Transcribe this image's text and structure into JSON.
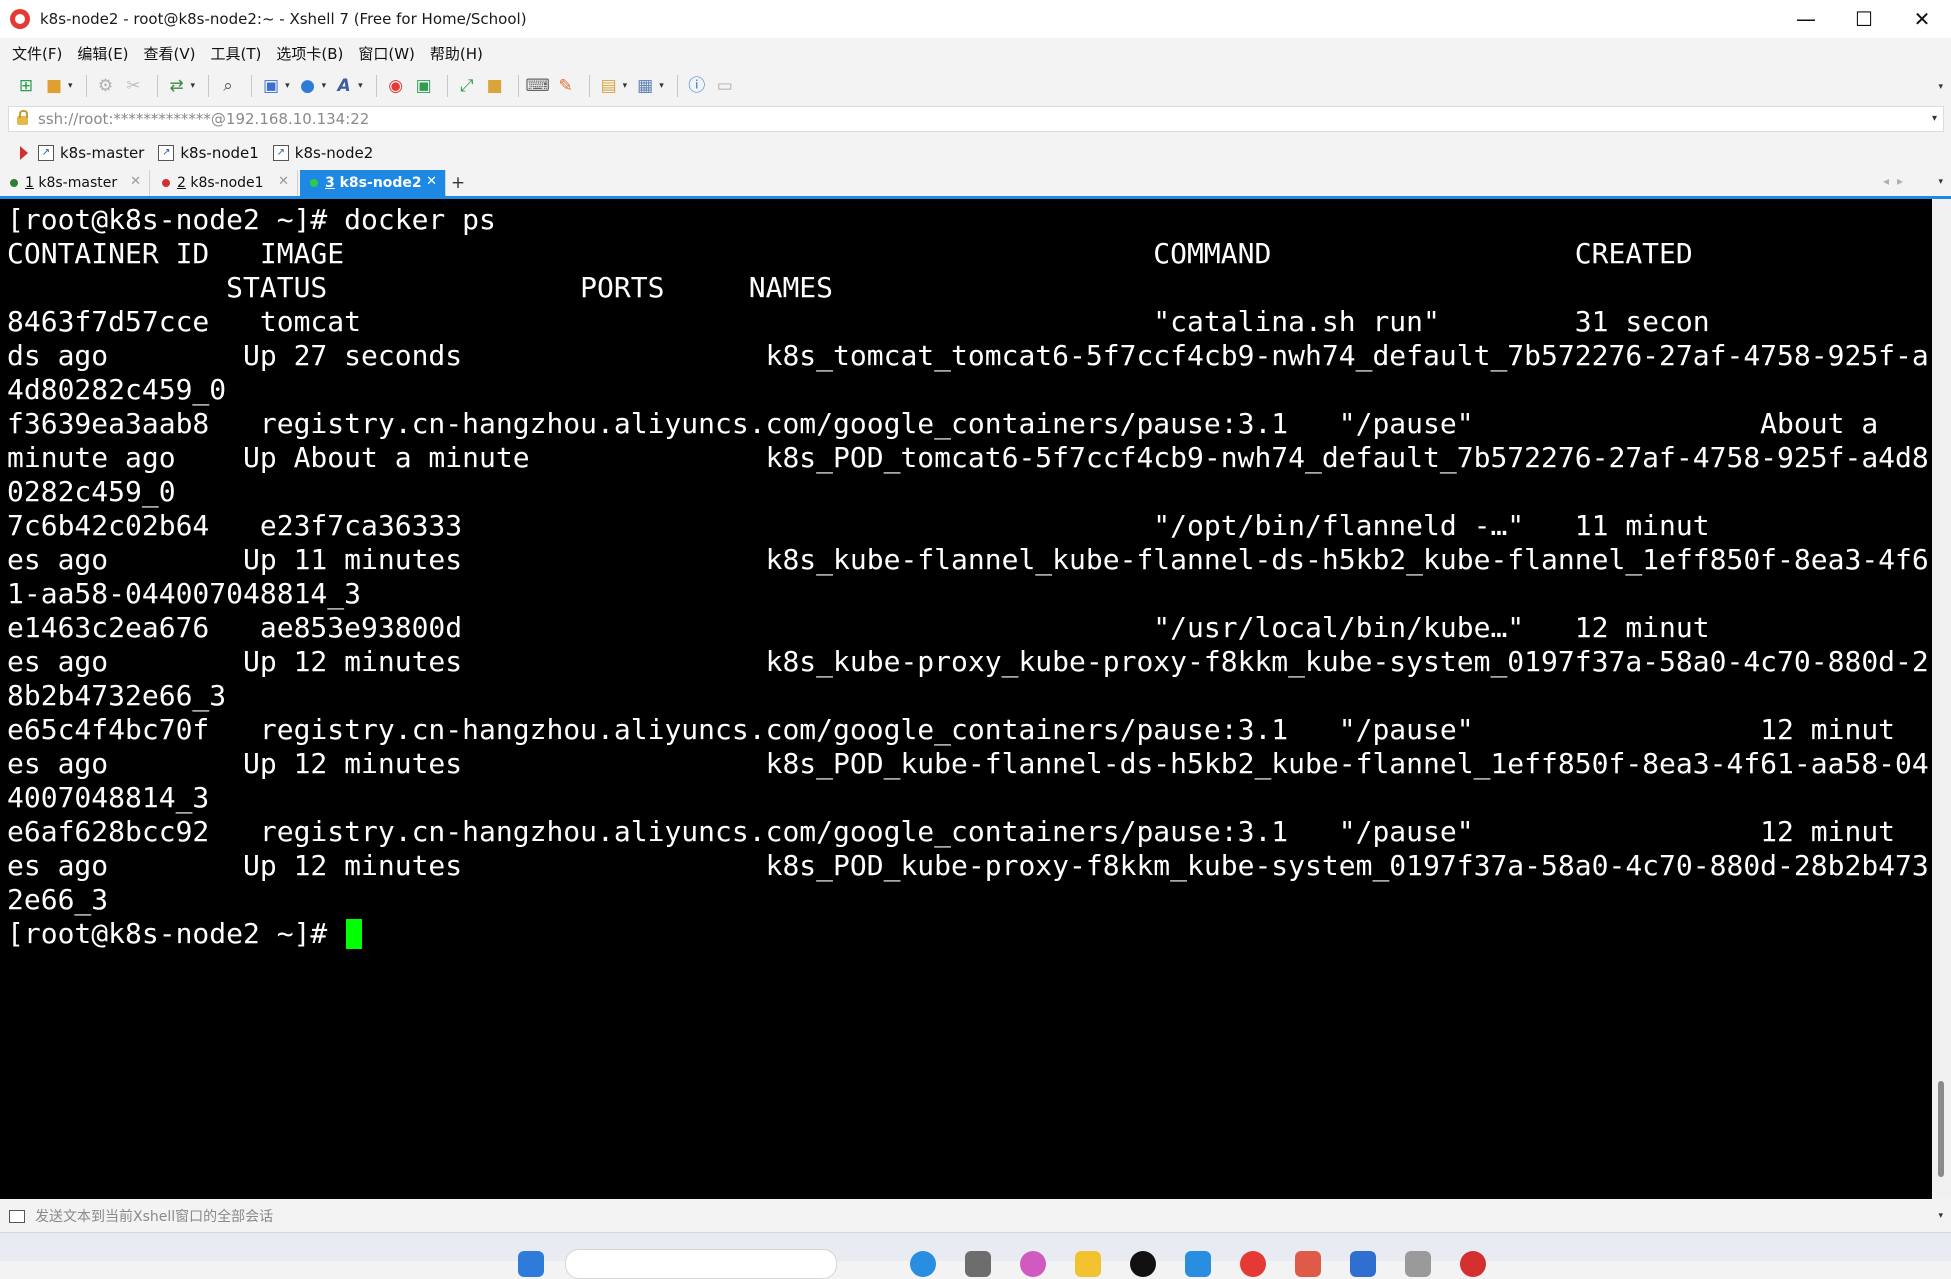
{
  "window": {
    "title": "k8s-node2 - root@k8s-node2:~ - Xshell 7 (Free for Home/School)",
    "minimize": "—",
    "maximize": "☐",
    "close": "✕"
  },
  "menu": [
    "文件(F)",
    "编辑(E)",
    "查看(V)",
    "工具(T)",
    "选项卡(B)",
    "窗口(W)",
    "帮助(H)"
  ],
  "address": {
    "value": "ssh://root:*************@192.168.10.134:22"
  },
  "links": [
    "k8s-master",
    "k8s-node1",
    "k8s-node2"
  ],
  "tabs": [
    {
      "number": "1",
      "label": "k8s-master",
      "dot_color": "#2e7d32"
    },
    {
      "number": "2",
      "label": "k8s-node1",
      "dot_color": "#d32f2f"
    },
    {
      "number": "3",
      "label": "k8s-node2",
      "dot_color": "#2e7d32"
    }
  ],
  "terminal": {
    "lines": [
      "[root@k8s-node2 ~]# docker ps",
      "CONTAINER ID   IMAGE                                                COMMAND                  CREATED",
      "             STATUS               PORTS     NAMES",
      "8463f7d57cce   tomcat                                               \"catalina.sh run\"        31 secon",
      "ds ago        Up 27 seconds                  k8s_tomcat_tomcat6-5f7ccf4cb9-nwh74_default_7b572276-27af-4758-925f-a",
      "4d80282c459_0",
      "f3639ea3aab8   registry.cn-hangzhou.aliyuncs.com/google_containers/pause:3.1   \"/pause\"                 About a",
      "minute ago    Up About a minute              k8s_POD_tomcat6-5f7ccf4cb9-nwh74_default_7b572276-27af-4758-925f-a4d8",
      "0282c459_0",
      "7c6b42c02b64   e23f7ca36333                                         \"/opt/bin/flanneld -…\"   11 minut",
      "es ago        Up 11 minutes                  k8s_kube-flannel_kube-flannel-ds-h5kb2_kube-flannel_1eff850f-8ea3-4f6",
      "1-aa58-044007048814_3",
      "e1463c2ea676   ae853e93800d                                         \"/usr/local/bin/kube…\"   12 minut",
      "es ago        Up 12 minutes                  k8s_kube-proxy_kube-proxy-f8kkm_kube-system_0197f37a-58a0-4c70-880d-2",
      "8b2b4732e66_3",
      "e65c4f4bc70f   registry.cn-hangzhou.aliyuncs.com/google_containers/pause:3.1   \"/pause\"                 12 minut",
      "es ago        Up 12 minutes                  k8s_POD_kube-flannel-ds-h5kb2_kube-flannel_1eff850f-8ea3-4f61-aa58-04",
      "4007048814_3",
      "e6af628bcc92   registry.cn-hangzhou.aliyuncs.com/google_containers/pause:3.1   \"/pause\"                 12 minut",
      "es ago        Up 12 minutes                  k8s_POD_kube-proxy-f8kkm_kube-system_0197f37a-58a0-4c70-880d-28b2b473",
      "2e66_3"
    ],
    "prompt": "[root@k8s-node2 ~]# ",
    "cursor_color": "#00ff00"
  },
  "status": {
    "text": "发送文本到当前Xshell窗口的全部会话"
  }
}
